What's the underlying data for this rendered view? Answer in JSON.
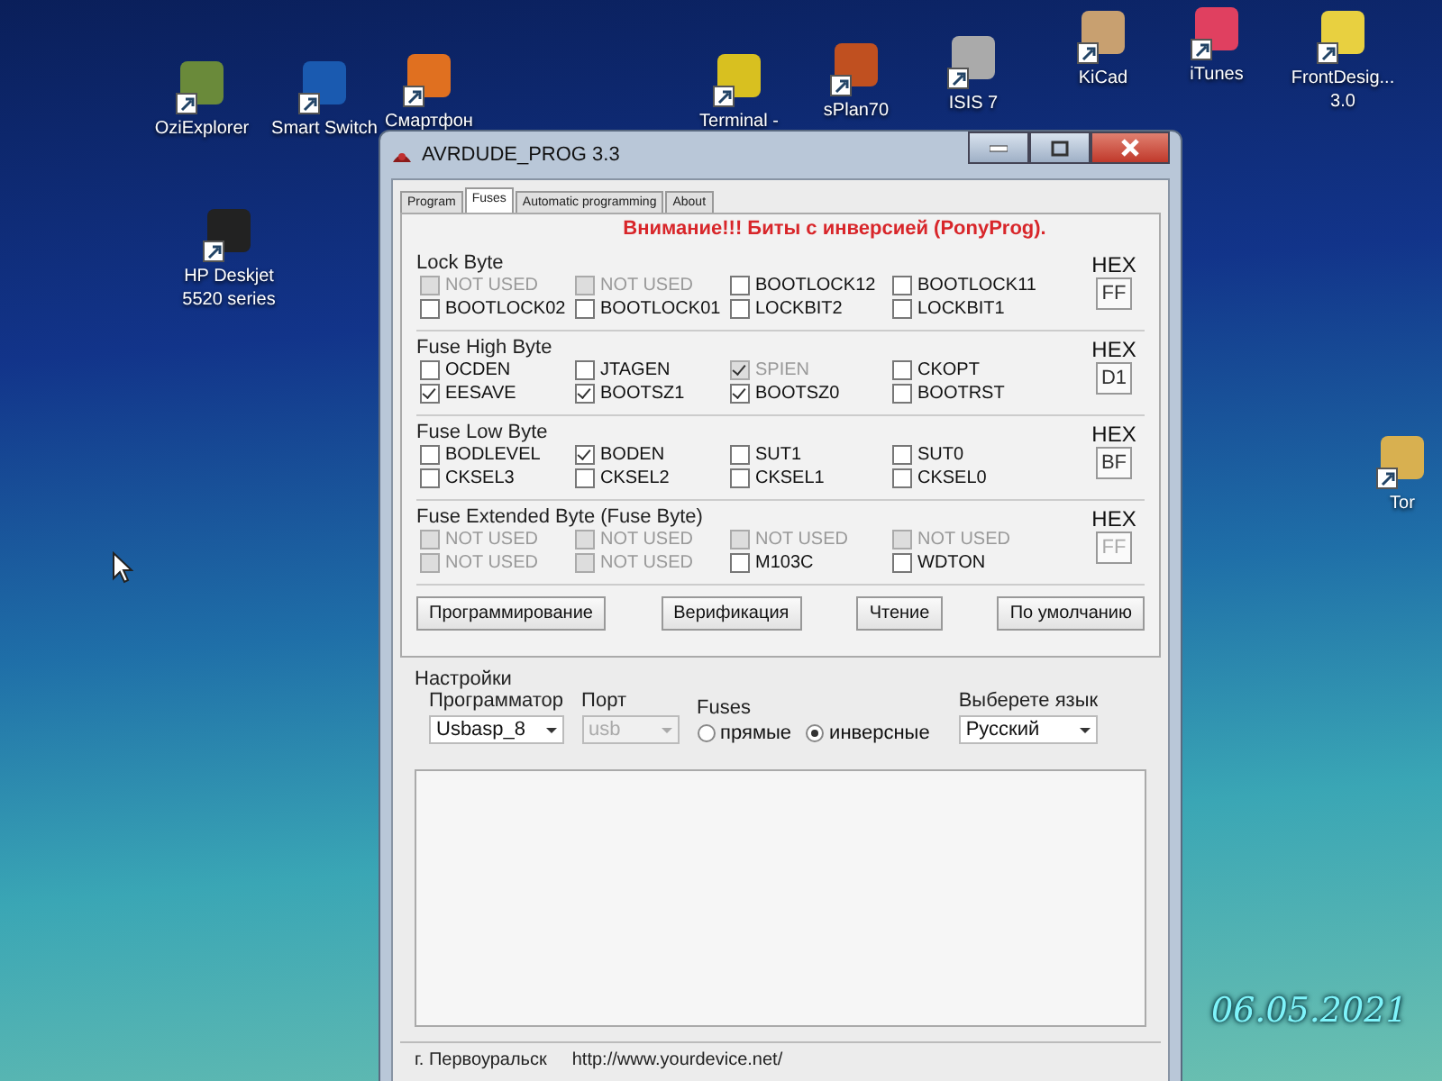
{
  "desktop": {
    "icons": [
      {
        "lines": [
          "OziExplorer"
        ]
      },
      {
        "lines": [
          "Smart Switch"
        ]
      },
      {
        "lines": [
          "Смартфон"
        ]
      },
      {
        "lines": [
          "Terminal -"
        ]
      },
      {
        "lines": [
          "sPlan70"
        ]
      },
      {
        "lines": [
          "ISIS 7"
        ]
      },
      {
        "lines": [
          "KiCad"
        ]
      },
      {
        "lines": [
          "iTunes"
        ]
      },
      {
        "lines": [
          "FrontDesig...",
          "3.0"
        ]
      },
      {
        "lines": [
          "HP Deskjet",
          "5520 series"
        ]
      },
      {
        "lines": [
          "Tor"
        ]
      }
    ],
    "date_stamp": "06.05.2021"
  },
  "window": {
    "title": "AVRDUDE_PROG 3.3",
    "tabs": [
      {
        "label": "Program",
        "selected": false
      },
      {
        "label": "Fuses",
        "selected": true
      },
      {
        "label": "Automatic programming",
        "selected": false
      },
      {
        "label": "About",
        "selected": false
      }
    ],
    "warning": "Внимание!!! Биты с инверсией (PonyProg).",
    "groups": [
      {
        "title": "Lock Byte",
        "hex_label": "HEX",
        "hex_value": "FF",
        "hex_disabled": false,
        "bits": [
          {
            "label": "NOT USED",
            "checked": false,
            "disabled": true
          },
          {
            "label": "NOT USED",
            "checked": false,
            "disabled": true
          },
          {
            "label": "BOOTLOCK12",
            "checked": false,
            "disabled": false
          },
          {
            "label": "BOOTLOCK11",
            "checked": false,
            "disabled": false
          },
          {
            "label": "BOOTLOCK02",
            "checked": false,
            "disabled": false
          },
          {
            "label": "BOOTLOCK01",
            "checked": false,
            "disabled": false
          },
          {
            "label": "LOCKBIT2",
            "checked": false,
            "disabled": false
          },
          {
            "label": "LOCKBIT1",
            "checked": false,
            "disabled": false
          }
        ]
      },
      {
        "title": "Fuse High Byte",
        "hex_label": "HEX",
        "hex_value": "D1",
        "hex_disabled": false,
        "bits": [
          {
            "label": "OCDEN",
            "checked": false,
            "disabled": false
          },
          {
            "label": "JTAGEN",
            "checked": false,
            "disabled": false
          },
          {
            "label": "SPIEN",
            "checked": true,
            "disabled": true
          },
          {
            "label": "CKOPT",
            "checked": false,
            "disabled": false
          },
          {
            "label": "EESAVE",
            "checked": true,
            "disabled": false
          },
          {
            "label": "BOOTSZ1",
            "checked": true,
            "disabled": false
          },
          {
            "label": "BOOTSZ0",
            "checked": true,
            "disabled": false
          },
          {
            "label": "BOOTRST",
            "checked": false,
            "disabled": false
          }
        ]
      },
      {
        "title": "Fuse Low Byte",
        "hex_label": "HEX",
        "hex_value": "BF",
        "hex_disabled": false,
        "bits": [
          {
            "label": "BODLEVEL",
            "checked": false,
            "disabled": false
          },
          {
            "label": "BODEN",
            "checked": true,
            "disabled": false
          },
          {
            "label": "SUT1",
            "checked": false,
            "disabled": false
          },
          {
            "label": "SUT0",
            "checked": false,
            "disabled": false
          },
          {
            "label": "CKSEL3",
            "checked": false,
            "disabled": false
          },
          {
            "label": "CKSEL2",
            "checked": false,
            "disabled": false
          },
          {
            "label": "CKSEL1",
            "checked": false,
            "disabled": false
          },
          {
            "label": "CKSEL0",
            "checked": false,
            "disabled": false
          }
        ]
      },
      {
        "title": "Fuse Extended Byte (Fuse Byte)",
        "hex_label": "HEX",
        "hex_value": "FF",
        "hex_disabled": true,
        "bits": [
          {
            "label": "NOT USED",
            "checked": false,
            "disabled": true
          },
          {
            "label": "NOT USED",
            "checked": false,
            "disabled": true
          },
          {
            "label": "NOT USED",
            "checked": false,
            "disabled": true
          },
          {
            "label": "NOT USED",
            "checked": false,
            "disabled": true
          },
          {
            "label": "NOT USED",
            "checked": false,
            "disabled": true
          },
          {
            "label": "NOT USED",
            "checked": false,
            "disabled": true
          },
          {
            "label": "M103C",
            "checked": false,
            "disabled": false
          },
          {
            "label": "WDTON",
            "checked": false,
            "disabled": false
          }
        ]
      }
    ],
    "buttons": [
      "Программирование",
      "Верификация",
      "Чтение",
      "По умолчанию"
    ],
    "settings": {
      "title": "Настройки",
      "programmer": {
        "label": "Программатор",
        "value": "Usbasp_8"
      },
      "port": {
        "label": "Порт",
        "value": "usb",
        "disabled": true
      },
      "fuses": {
        "label": "Fuses",
        "options": [
          {
            "label": "прямые",
            "selected": false
          },
          {
            "label": "инверсные",
            "selected": true
          }
        ]
      },
      "language": {
        "label": "Выберете язык",
        "value": "Русский"
      }
    },
    "status_bar": [
      "г. Первоуральск",
      "http://www.yourdevice.net/"
    ]
  }
}
